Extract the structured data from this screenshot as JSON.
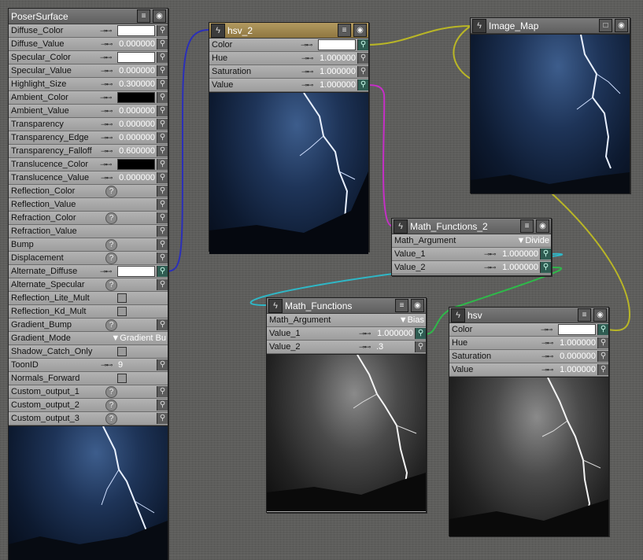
{
  "poser_surface": {
    "title": "PoserSurface",
    "rows": [
      {
        "label": "Diffuse_Color",
        "kind": "swatch",
        "color": "#ffffff"
      },
      {
        "label": "Diffuse_Value",
        "kind": "value",
        "value": "0.000000"
      },
      {
        "label": "Specular_Color",
        "kind": "swatch",
        "color": "#ffffff"
      },
      {
        "label": "Specular_Value",
        "kind": "value",
        "value": "0.000000"
      },
      {
        "label": "Highlight_Size",
        "kind": "value",
        "value": "0.300000"
      },
      {
        "label": "Ambient_Color",
        "kind": "swatch",
        "color": "#000000"
      },
      {
        "label": "Ambient_Value",
        "kind": "value",
        "value": "0.000000"
      },
      {
        "label": "Transparency",
        "kind": "value",
        "value": "0.000000"
      },
      {
        "label": "Transparency_Edge",
        "kind": "value",
        "value": "0.000000"
      },
      {
        "label": "Transparency_Falloff",
        "kind": "value",
        "value": "0.600000"
      },
      {
        "label": "Translucence_Color",
        "kind": "swatch",
        "color": "#000000"
      },
      {
        "label": "Translucence_Value",
        "kind": "value",
        "value": "0.000000"
      },
      {
        "label": "Reflection_Color",
        "kind": "question"
      },
      {
        "label": "Reflection_Value",
        "kind": "plain"
      },
      {
        "label": "Refraction_Color",
        "kind": "question"
      },
      {
        "label": "Refraction_Value",
        "kind": "plain"
      },
      {
        "label": "Bump",
        "kind": "question"
      },
      {
        "label": "Displacement",
        "kind": "question"
      },
      {
        "label": "Alternate_Diffuse",
        "kind": "swatch",
        "color": "#ffffff",
        "active": true
      },
      {
        "label": "Alternate_Specular",
        "kind": "question"
      },
      {
        "label": "Reflection_Lite_Mult",
        "kind": "checkbox"
      },
      {
        "label": "Reflection_Kd_Mult",
        "kind": "checkbox"
      },
      {
        "label": "Gradient_Bump",
        "kind": "question"
      },
      {
        "label": "Gradient_Mode",
        "kind": "dropdown",
        "value": "Gradient Bu"
      },
      {
        "label": "Shadow_Catch_Only",
        "kind": "checkbox"
      },
      {
        "label": "ToonID",
        "kind": "value",
        "value": "9",
        "align": "left"
      },
      {
        "label": "Normals_Forward",
        "kind": "checkbox"
      },
      {
        "label": "Custom_output_1",
        "kind": "question"
      },
      {
        "label": "Custom_output_2",
        "kind": "question"
      },
      {
        "label": "Custom_output_3",
        "kind": "question"
      }
    ]
  },
  "hsv_2": {
    "title": "hsv_2",
    "rows": [
      {
        "label": "Color",
        "kind": "swatch",
        "color": "#ffffff",
        "active": true
      },
      {
        "label": "Hue",
        "kind": "value",
        "value": "1.000000"
      },
      {
        "label": "Saturation",
        "kind": "value",
        "value": "1.000000"
      },
      {
        "label": "Value",
        "kind": "value",
        "value": "1.000000",
        "active": true
      }
    ]
  },
  "image_map": {
    "title": "Image_Map"
  },
  "math_functions_2": {
    "title": "Math_Functions_2",
    "rows": [
      {
        "label": "Math_Argument",
        "kind": "dropdown",
        "value": "Divide"
      },
      {
        "label": "Value_1",
        "kind": "value",
        "value": "1.000000",
        "active": true
      },
      {
        "label": "Value_2",
        "kind": "value",
        "value": "1.000000",
        "active": true
      }
    ]
  },
  "math_functions": {
    "title": "Math_Functions",
    "rows": [
      {
        "label": "Math_Argument",
        "kind": "dropdown",
        "value": "Bias"
      },
      {
        "label": "Value_1",
        "kind": "value",
        "value": "1.000000",
        "active": true
      },
      {
        "label": "Value_2",
        "kind": "value",
        "value": ".3",
        "align": "left"
      }
    ]
  },
  "hsv": {
    "title": "hsv",
    "rows": [
      {
        "label": "Color",
        "kind": "swatch",
        "color": "#ffffff",
        "active": true
      },
      {
        "label": "Hue",
        "kind": "value",
        "value": "1.000000"
      },
      {
        "label": "Saturation",
        "kind": "value",
        "value": "0.000000"
      },
      {
        "label": "Value",
        "kind": "value",
        "value": "1.000000"
      }
    ]
  },
  "colors": {
    "wire_blue": "#2b2fb8",
    "wire_yellow": "#b9b626",
    "wire_magenta": "#c52fc6",
    "wire_cyan": "#2fb7c6",
    "wire_green": "#2fb84a"
  }
}
